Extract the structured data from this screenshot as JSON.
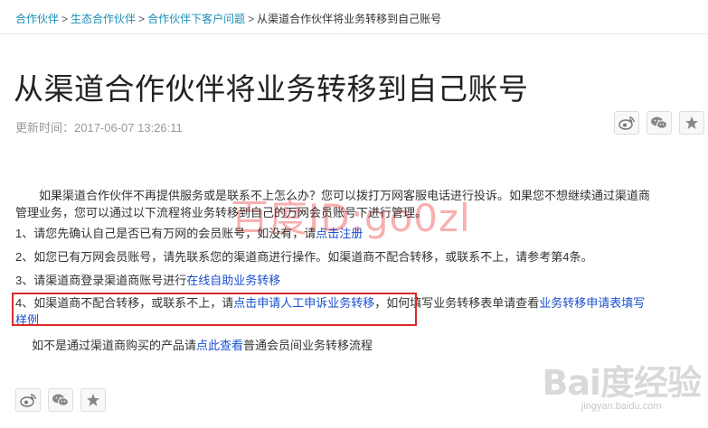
{
  "breadcrumb": {
    "items": [
      "合作伙伴",
      "生态合作伙伴",
      "合作伙伴下客户问题"
    ],
    "separator": ">",
    "current": "从渠道合作伙伴将业务转移到自己账号"
  },
  "article": {
    "title": "从渠道合作伙伴将业务转移到自己账号",
    "updated_label": "更新时间：",
    "updated_value": "2017-06-07 13:26:11"
  },
  "share": {
    "icons": [
      "weibo-icon",
      "wechat-icon",
      "star-icon"
    ]
  },
  "content": {
    "p1": {
      "line1": "如果渠道合作伙伴不再提供服务或是联系不上怎么办？您可以拨打万网客服电话进行投诉。如果您不想继续通过渠道商",
      "line2": "管理业务，您可以通过以下流程将业务转移到自己的万网会员账号下进行管理。"
    },
    "p2": {
      "text": "1、请您先确认自己是否已有万网的会员账号，如没有，请",
      "link": "点击注册"
    },
    "p3": {
      "text": "2、如您已有万网会员账号，请先联系您的渠道商进行操作。如渠道商不配合转移，或联系不上，请参考第4条。"
    },
    "p4": {
      "text": "3、请渠道商登录渠道商账号进行",
      "link": "在线自助业务转移"
    },
    "p5": {
      "text1": "4、如渠道商不配合转移，或联系不上，请",
      "link1": "点击申请人工申诉业务转移",
      "text2": "，如何填写业务转移表单请查看",
      "link2a": "业务转移申请表填写",
      "link2b": "样例"
    },
    "p6": {
      "text1": "如不是通过渠道商购买的产品请",
      "link": "点此查看",
      "text2": "普通会员间业务转移流程"
    }
  },
  "watermark": {
    "text": "百度ID:go0zl",
    "logo": "Bai度经验",
    "url": "jingyan.baidu.com"
  },
  "colors": {
    "link": "#1a4fd0",
    "breadcrumb_link": "#1a8fb5",
    "highlight_border": "#d92b2b"
  }
}
